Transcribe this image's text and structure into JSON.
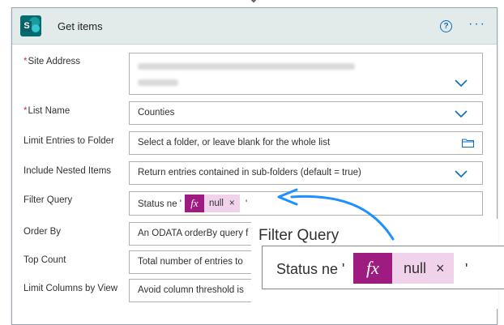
{
  "action": {
    "title": "Get items",
    "help_icon": "?",
    "more_icon": "···"
  },
  "fields": [
    {
      "label": "Site Address",
      "required": true,
      "value": "",
      "placeholder": ""
    },
    {
      "label": "List Name",
      "required": true,
      "value": "Counties"
    },
    {
      "label": "Limit Entries to Folder",
      "required": false,
      "value": "Select a folder, or leave blank for the whole list"
    },
    {
      "label": "Include Nested Items",
      "required": false,
      "value": "Return entries contained in sub-folders (default = true)"
    },
    {
      "label": "Filter Query",
      "required": false,
      "value_prefix": "Status ne '",
      "token": "null",
      "value_suffix": "'"
    },
    {
      "label": "Order By",
      "required": false,
      "value": "An ODATA orderBy query f"
    },
    {
      "label": "Top Count",
      "required": false,
      "value": "Total number of entries to"
    },
    {
      "label": "Limit Columns by View",
      "required": false,
      "value": "Avoid column threshold is"
    }
  ],
  "required_mark": "*",
  "token_remove": "×",
  "fx_symbol": "fx",
  "zoom": {
    "title": "Filter Query",
    "prefix": "Status ne '",
    "token": "null",
    "suffix": "'"
  },
  "colors": {
    "header_bg": "#e2ebea",
    "accent": "#0f6cbd",
    "required": "#c4314b",
    "fx_bg": "#9e1b80",
    "token_bg": "#f0d2ea",
    "annotation_arrow": "#1e90ff"
  },
  "icons": {
    "app": "sharepoint-icon",
    "dropdown": "chevron-down-icon",
    "folder": "folder-icon",
    "help": "help-icon",
    "more": "ellipsis-icon"
  }
}
